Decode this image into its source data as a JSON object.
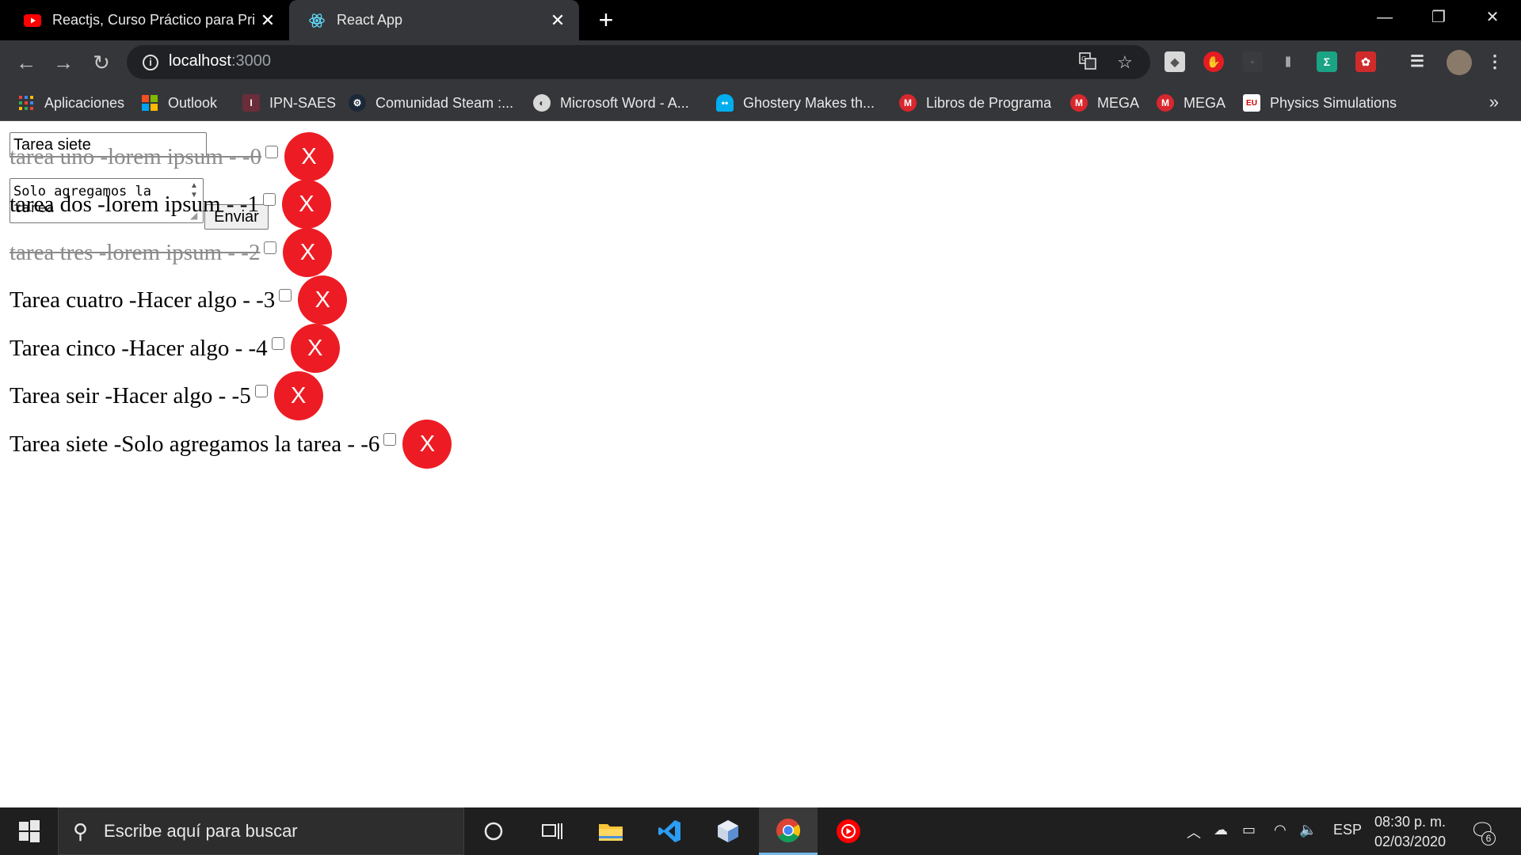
{
  "tabs": [
    {
      "title": "Reactjs, Curso Práctico para Princ",
      "favicon": "youtube-icon"
    },
    {
      "title": "React App",
      "favicon": "react-icon"
    }
  ],
  "address": {
    "host": "localhost",
    "port": ":3000"
  },
  "bookmarks": [
    {
      "label": "Aplicaciones",
      "icon": "apps-grid-icon"
    },
    {
      "label": "Outlook",
      "icon": "outlook-icon"
    },
    {
      "label": "IPN-SAES",
      "icon": "ipn-icon"
    },
    {
      "label": "Comunidad Steam :...",
      "icon": "steam-icon"
    },
    {
      "label": "Microsoft Word - A...",
      "icon": "globe-icon"
    },
    {
      "label": "Ghostery Makes th...",
      "icon": "ghostery-icon"
    },
    {
      "label": "Libros de Programa",
      "icon": "mega-icon"
    },
    {
      "label": "MEGA",
      "icon": "mega-icon"
    },
    {
      "label": "MEGA",
      "icon": "mega-icon"
    },
    {
      "label": "Physics Simulations",
      "icon": "eu-icon"
    }
  ],
  "bookmarks_more": "»",
  "form": {
    "title_value": "Tarea siete",
    "description_value": "Solo agregamos la\ntarea",
    "submit_label": "Enviar"
  },
  "tasks": [
    {
      "text": "tarea uno -lorem ipsum - -0",
      "done": true
    },
    {
      "text": "tarea dos -lorem ipsum - -1",
      "done": false
    },
    {
      "text": "tarea tres -lorem ipsum - -2",
      "done": true
    },
    {
      "text": "Tarea cuatro -Hacer algo - -3",
      "done": false
    },
    {
      "text": "Tarea cinco -Hacer algo - -4",
      "done": false
    },
    {
      "text": "Tarea seir -Hacer algo - -5",
      "done": false
    },
    {
      "text": "Tarea siete -Solo agregamos la tarea - -6",
      "done": false
    }
  ],
  "delete_label": "X",
  "taskbar": {
    "search_placeholder": "Escribe aquí para buscar",
    "language": "ESP",
    "time": "08:30 p. m.",
    "date": "02/03/2020",
    "notifications": "6"
  },
  "colors": {
    "delete_button": "#ed1c24",
    "tab_active": "#35363a",
    "taskbar": "#1f1f1f"
  }
}
